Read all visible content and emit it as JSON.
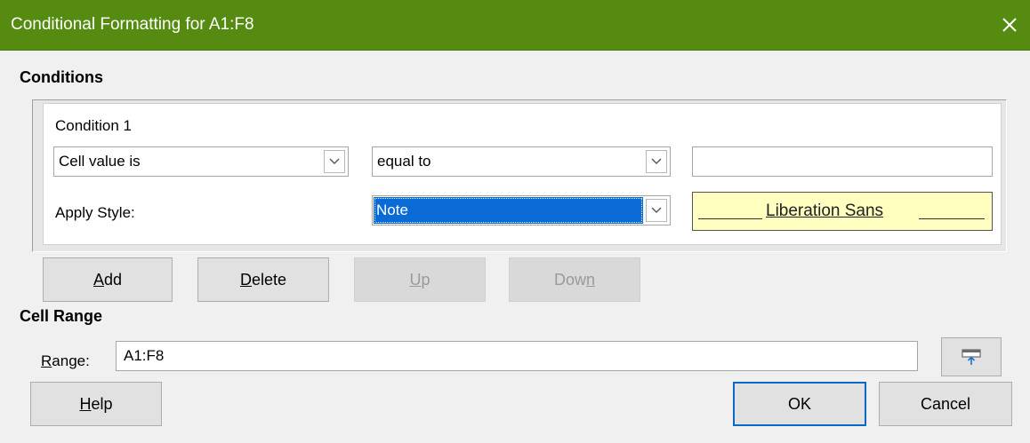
{
  "window": {
    "title": "Conditional Formatting for A1:F8",
    "titlebar_color": "#548b10"
  },
  "conditions": {
    "section_title": "Conditions",
    "condition_title": "Condition 1",
    "type_select": "Cell value is",
    "operator_select": "equal to",
    "value_input": "",
    "apply_style_label": "Apply Style:",
    "style_select": "Note",
    "preview_text": "Liberation Sans",
    "preview_bg": "#ffffc0"
  },
  "buttons": {
    "add": {
      "mnemonic": "A",
      "rest": "dd"
    },
    "delete": {
      "mnemonic": "D",
      "rest": "elete"
    },
    "up": {
      "mnemonic": "U",
      "rest": "p"
    },
    "down": {
      "pre": "Dow",
      "mnemonic": "n"
    },
    "help": {
      "mnemonic": "H",
      "rest": "elp"
    },
    "ok": "OK",
    "cancel": "Cancel"
  },
  "cell_range": {
    "section_title": "Cell Range",
    "range_label_mnemonic": "R",
    "range_label_rest": "ange:",
    "range_value": "A1:F8"
  },
  "icons": {
    "close": "close-icon",
    "dropdown": "chevron-down-icon",
    "shrink": "shrink-dialog-icon"
  },
  "colors": {
    "selection": "#0a6bd6",
    "default_button_border": "#0a68c9"
  }
}
